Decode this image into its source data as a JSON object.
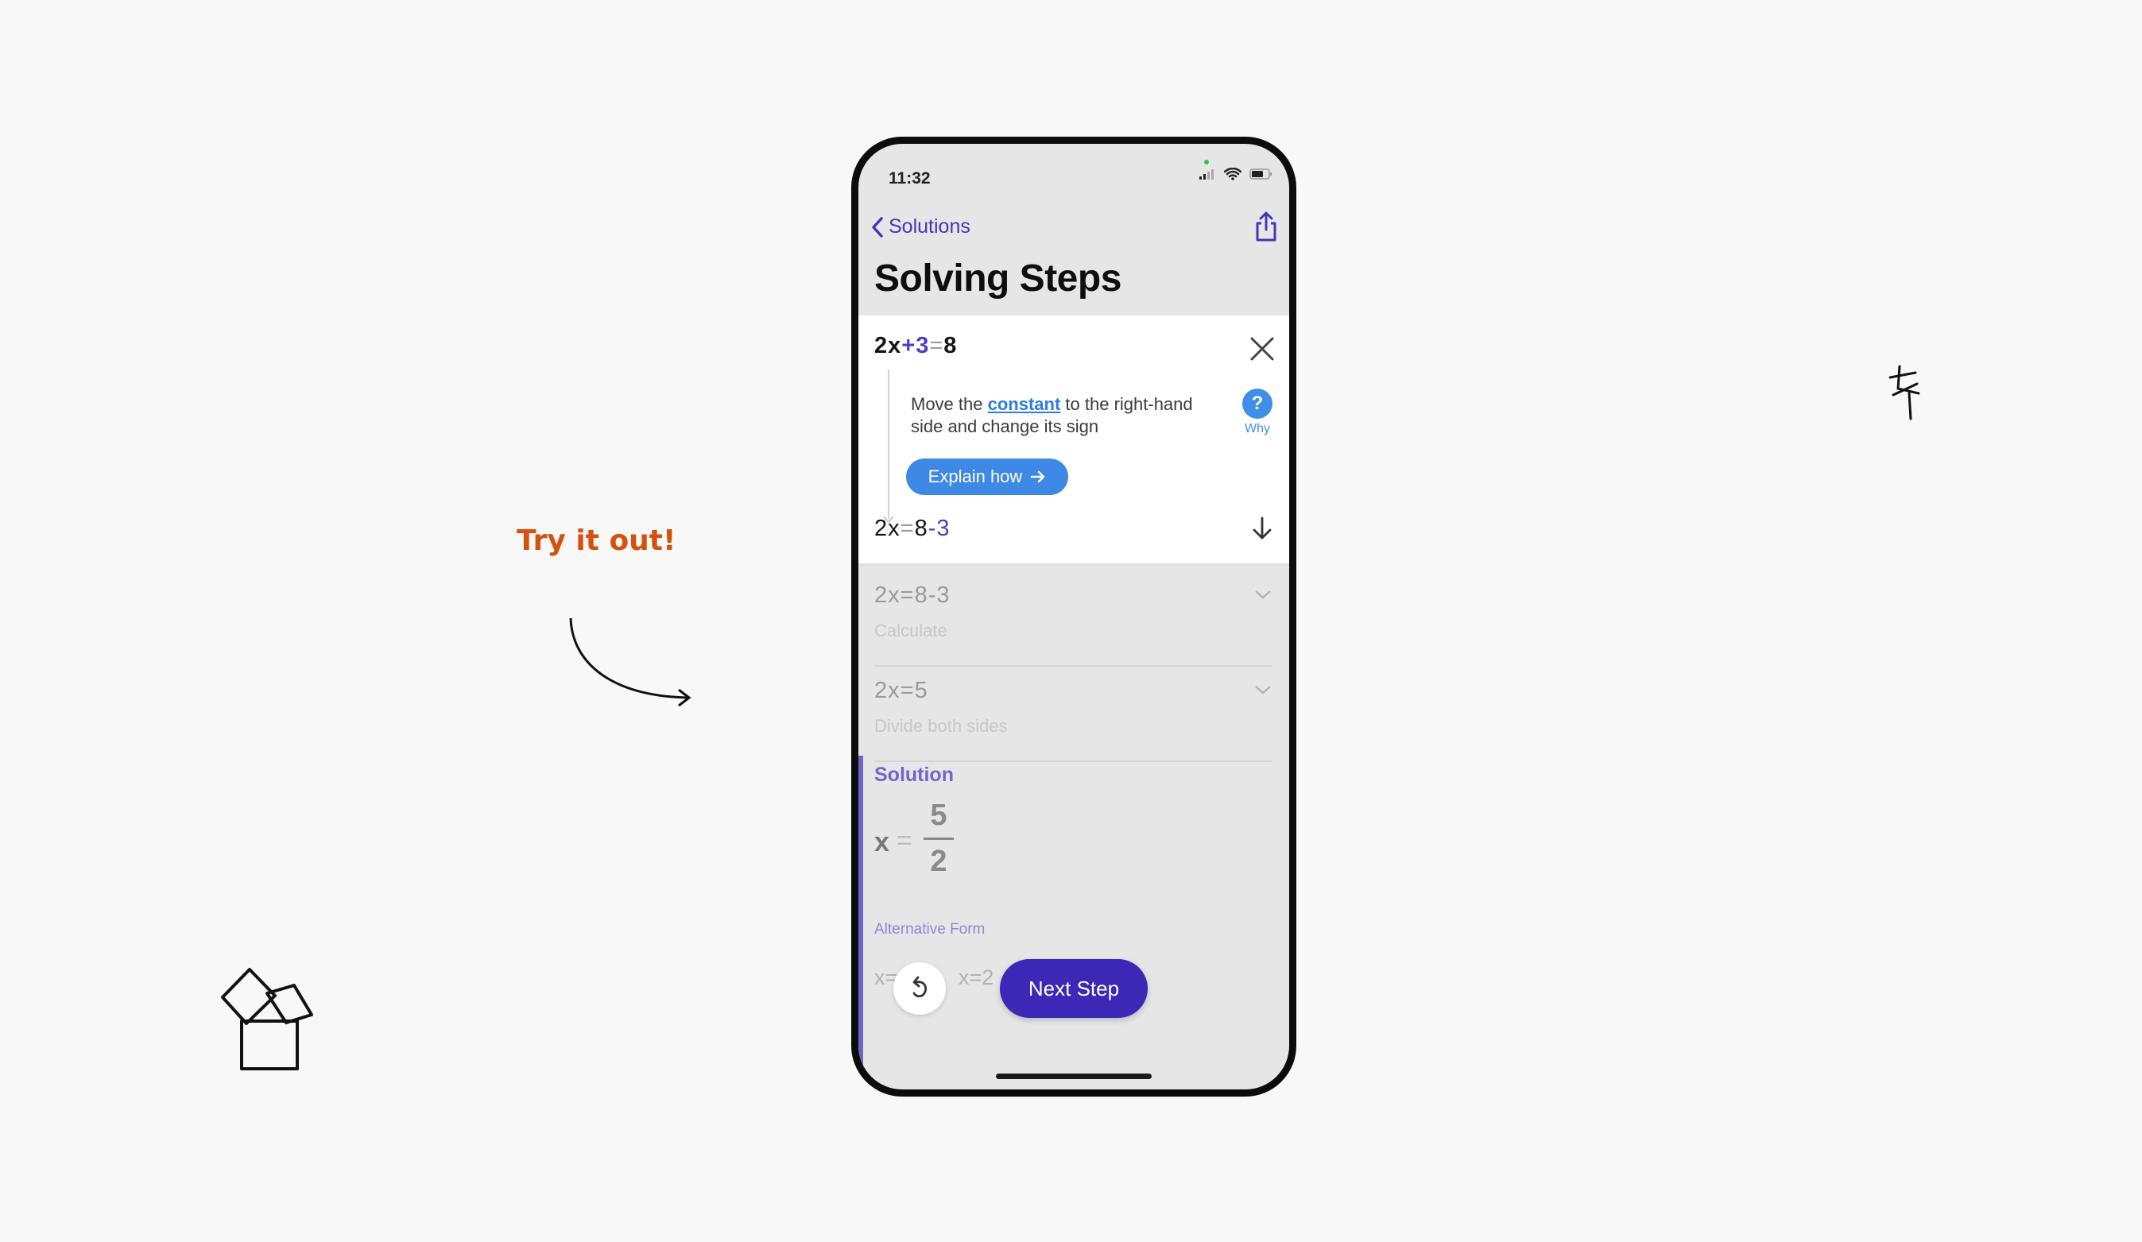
{
  "overlay": {
    "cta_text": "Try it out!"
  },
  "status_bar": {
    "time": "11:32"
  },
  "nav": {
    "back_label": "Solutions"
  },
  "page": {
    "title": "Solving Steps"
  },
  "current_step": {
    "equation_top": {
      "a": "2x",
      "op": "+3",
      "eq": "=",
      "rhs": "8"
    },
    "description_before": "Move the ",
    "description_link": "constant",
    "description_after": " to the right-hand side and change its sign",
    "why_label": "Why",
    "why_symbol": "?",
    "explain_button": "Explain how",
    "equation_bottom": {
      "lhs": "2x",
      "eq": "=",
      "a": "8",
      "op": "-3"
    }
  },
  "steps": [
    {
      "equation": "2x=8-3",
      "caption": "Calculate"
    },
    {
      "equation": "2x=5",
      "caption": "Divide both sides"
    }
  ],
  "solution": {
    "label": "Solution",
    "variable": "x",
    "equals": "=",
    "numerator": "5",
    "denominator": "2",
    "alternative_label": "Alternative Form",
    "alt_value_1": "x=",
    "alt_value_2": "x=2"
  },
  "controls": {
    "next_step": "Next Step"
  },
  "colors": {
    "accent": "#3c27b6",
    "link": "#2f7ae5",
    "cta": "#d2520e"
  }
}
